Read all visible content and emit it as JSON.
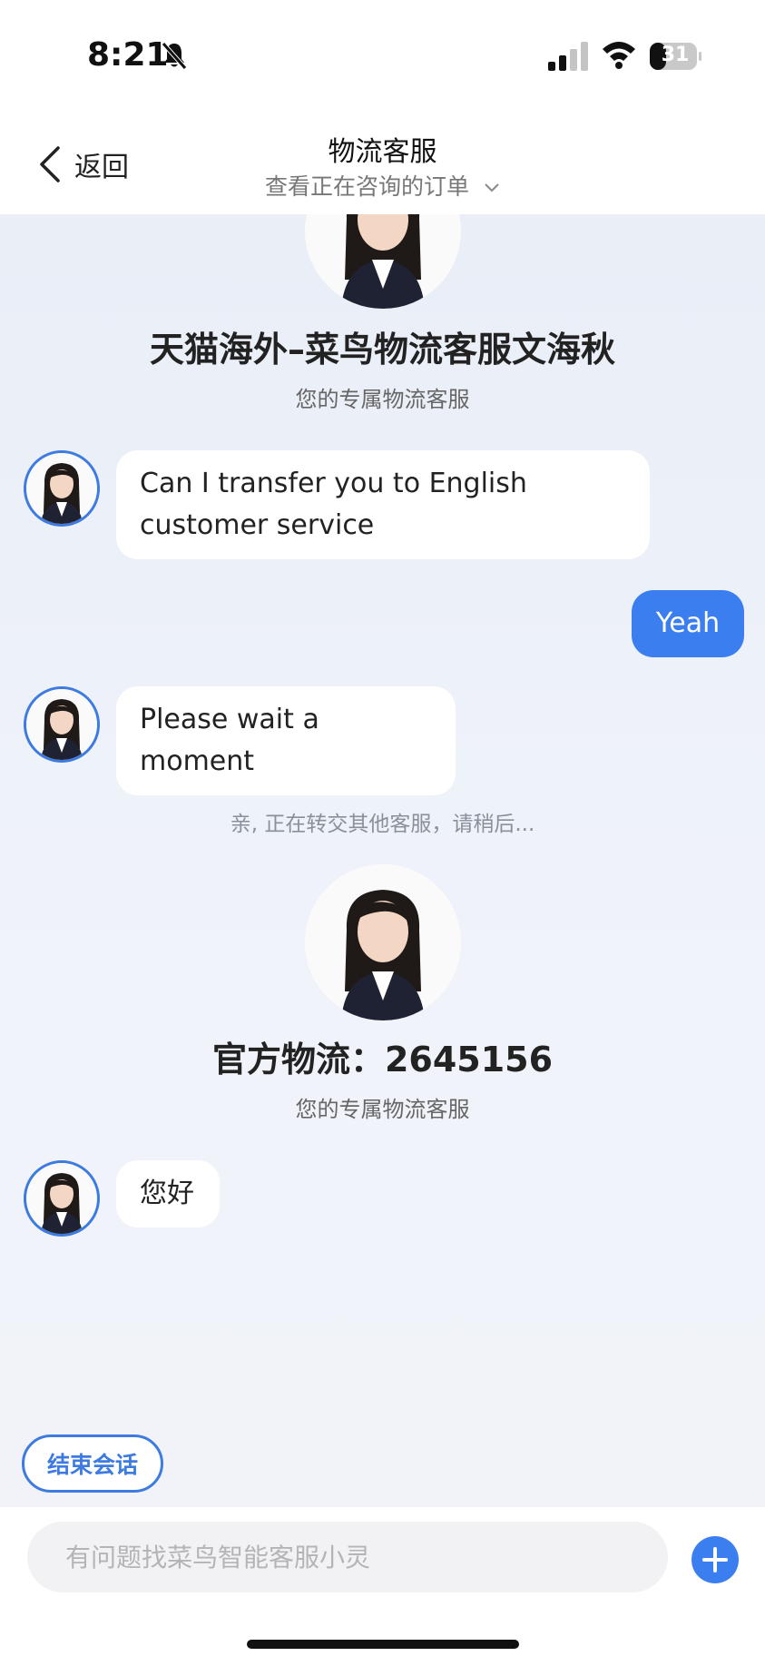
{
  "status_bar": {
    "time": "8:21",
    "battery": "31"
  },
  "nav": {
    "back_label": "返回",
    "title": "物流客服",
    "subtitle": "查看正在咨询的订单"
  },
  "agent1": {
    "name": "天猫海外–菜鸟物流客服文海秋",
    "role": "您的专属物流客服"
  },
  "messages": [
    {
      "from": "agent",
      "text_lines": [
        "Can I transfer you to English",
        "customer service"
      ]
    },
    {
      "from": "me",
      "text": "Yeah"
    },
    {
      "from": "agent",
      "text": "Please wait a moment"
    }
  ],
  "system_note": "亲, 正在转交其他客服，请稍后...",
  "agent2": {
    "name": "官方物流：2645156",
    "role": "您的专属物流客服"
  },
  "greeting": "您好",
  "end_session_label": "结束会话",
  "input": {
    "placeholder": "有问题找菜鸟智能客服小灵",
    "value": ""
  },
  "colors": {
    "accent": "#3b7ef0",
    "chat_bg": "#eef1f8"
  }
}
